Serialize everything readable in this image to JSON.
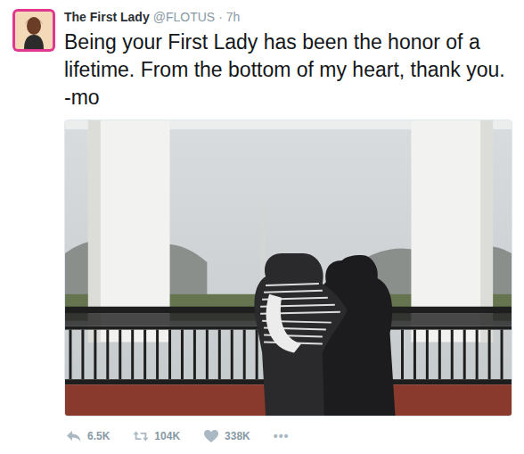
{
  "author": {
    "name": "The First Lady",
    "handle": "@FLOTUS",
    "separator": "·",
    "time": "7h"
  },
  "tweet": {
    "text": "Being your First Lady has been the honor of a lifetime. From the bottom of my heart, thank you. -mo"
  },
  "actions": [
    {
      "kind": "reply",
      "count": "6.5K"
    },
    {
      "kind": "retweet",
      "count": "104K"
    },
    {
      "kind": "like",
      "count": "338K"
    },
    {
      "kind": "more",
      "count": "•••"
    }
  ]
}
